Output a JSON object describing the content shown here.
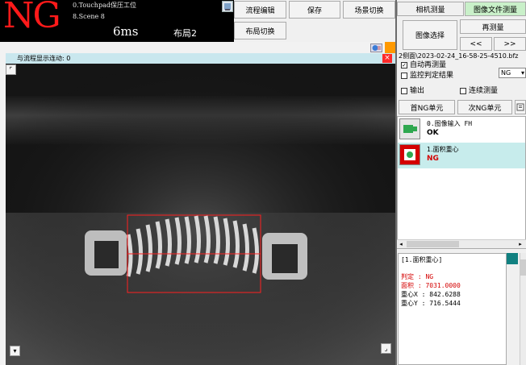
{
  "status": {
    "judge": "NG",
    "scene_line1": "0.Touchpad保压工位",
    "scene_line2": "8.Scene 8",
    "time": "6ms",
    "layout": "布局2"
  },
  "toolbar": {
    "flow_edit": "流程编辑",
    "save": "保存",
    "scene_switch": "场景切换",
    "layout_switch": "布局切换"
  },
  "image_panel": {
    "title": "与流程显示连动: 0",
    "close": "×"
  },
  "right": {
    "tabs": [
      "相机测量",
      "图像文件测量"
    ],
    "image_select": "图像选择",
    "remeasure": "再测量",
    "prev": "<<",
    "next": ">>",
    "file_path": "2侧面\\2023-02-24_16-58-25-4510.bfz",
    "auto_remeasure": "自动再测量",
    "monitor_result": "监控判定结果",
    "monitor_value": "NG",
    "output": "输出",
    "continuous": "连续测量",
    "first_ng": "首NG单元",
    "next_ng": "次NG单元",
    "units": [
      {
        "name": "0.图像输入 FH",
        "result": "OK",
        "color": "#000000"
      },
      {
        "name": "1.面积重心",
        "result": "NG",
        "color": "#d40000"
      }
    ]
  },
  "result": {
    "header": "[1.面积重心]",
    "lines": [
      {
        "text": "判定 : NG",
        "color": "#d40000"
      },
      {
        "text": "面积 : 7031.0000",
        "color": "#d40000"
      },
      {
        "text": "重心X : 842.6288",
        "color": "#000000"
      },
      {
        "text": "重心Y : 716.5444",
        "color": "#000000"
      }
    ]
  }
}
